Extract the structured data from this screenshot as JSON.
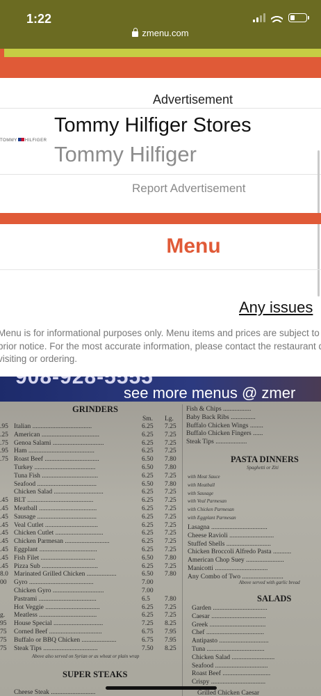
{
  "status_bar": {
    "time": "1:22",
    "battery_level": 0.3
  },
  "browser": {
    "url": "zmenu.com"
  },
  "ad": {
    "label": "Advertisement",
    "logo_text": "TOMMY HILFIGER",
    "title": "Tommy Hilfiger Stores",
    "subtitle": "Tommy Hilfiger",
    "report": "Report Advertisement"
  },
  "menu_heading": "Menu",
  "issues_link": "Any issues",
  "disclaimer": [
    "Menu is for informational purposes only. Menu items and prices are subject to",
    "prior notice. For the most accurate information, please contact the restaurant d",
    "visiting or ordering."
  ],
  "menu_image": {
    "banner_phone": "908-928-5555",
    "banner_text": "see more menus @ zmer",
    "grinders": {
      "title": "GRINDERS",
      "size_headers": [
        "Sm.",
        "Lg."
      ],
      "items": [
        {
          "name": "Italian",
          "sm": "6.25",
          "lg": "7.25"
        },
        {
          "name": "American",
          "sm": "6.25",
          "lg": "7.25"
        },
        {
          "name": "Genoa Salami",
          "sm": "6.25",
          "lg": "7.25"
        },
        {
          "name": "Ham",
          "sm": "6.25",
          "lg": "7.25"
        },
        {
          "name": "Roast Beef",
          "sm": "6.50",
          "lg": "7.80"
        },
        {
          "name": "Turkey",
          "sm": "6.50",
          "lg": "7.80"
        },
        {
          "name": "Tuna Fish",
          "sm": "6.25",
          "lg": "7.25"
        },
        {
          "name": "Seafood",
          "sm": "6.50",
          "lg": "7.80"
        },
        {
          "name": "Chicken Salad",
          "sm": "6.25",
          "lg": "7.25"
        },
        {
          "name": "BLT",
          "sm": "6.25",
          "lg": "7.25"
        },
        {
          "name": "Meatball",
          "sm": "6.25",
          "lg": "7.25"
        },
        {
          "name": "Sausage",
          "sm": "6.25",
          "lg": "7.25"
        },
        {
          "name": "Veal Cutlet",
          "sm": "6.25",
          "lg": "7.25"
        },
        {
          "name": "Chicken Cutlet",
          "sm": "6.25",
          "lg": "7.25"
        },
        {
          "name": "Chicken Parmesan",
          "sm": "6.25",
          "lg": "7.25"
        },
        {
          "name": "Eggplant",
          "sm": "6.25",
          "lg": "7.25"
        },
        {
          "name": "Fish Filet",
          "sm": "6.50",
          "lg": "7.80"
        },
        {
          "name": "Pizza Sub",
          "sm": "6.25",
          "lg": "7.25"
        },
        {
          "name": "Marinated Grilled Chicken",
          "sm": "6.50",
          "lg": "7.80"
        },
        {
          "name": "Gyro",
          "sm": "7.00",
          "lg": ""
        },
        {
          "name": "Chicken Gyro",
          "sm": "7.00",
          "lg": ""
        },
        {
          "name": "Pastrami",
          "sm": "6.5",
          "lg": "7.80"
        },
        {
          "name": "Hot Veggie",
          "sm": "6.25",
          "lg": "7.25"
        },
        {
          "name": "Meatless",
          "sm": "6.25",
          "lg": "7.25"
        },
        {
          "name": "House Special",
          "sm": "7.25",
          "lg": "8.25"
        },
        {
          "name": "Corned Beef",
          "sm": "6.75",
          "lg": "7.95"
        },
        {
          "name": "Buffalo or BBQ Chicken",
          "sm": "6.75",
          "lg": "7.95"
        },
        {
          "name": "Steak Tips",
          "sm": "7.50",
          "lg": "8.25"
        }
      ],
      "note": "Above also served on Syrian or as wheat or plain wrap"
    },
    "left_edge_prices": [
      ".95",
      ".25",
      ".75",
      ".95",
      ".75",
      "",
      "",
      "",
      "",
      ".45",
      ".45",
      ".45",
      ".45",
      ".45",
      ".45",
      ".45",
      ".45",
      ".45",
      "8.0",
      "00",
      "",
      "",
      "",
      "g.",
      "95",
      "75",
      "75",
      "75"
    ],
    "super_steaks": {
      "title": "SUPER STEAKS",
      "first_item": "Cheese Steak"
    },
    "right_top": [
      "Fish & Chips",
      "Baby Back Ribs",
      "Buffalo Chicken Wings",
      "Buffalo Chicken Fingers",
      "Steak Tips"
    ],
    "pasta": {
      "title": "PASTA DINNERS",
      "subtitle": "Spaghetti or Ziti",
      "options": [
        "with Meat Sauce",
        "with Meatball",
        "with Sausage",
        "with Veal Parmesan",
        "with Chicken Parmesan",
        "with Eggplant Parmesan"
      ],
      "items": [
        "Lasagna",
        "Cheese Ravioli",
        "Stuffed Shells",
        "Chicken Broccoli Alfredo Pasta",
        "American Chop Suey",
        "Manicotti",
        "Any Combo of Two"
      ],
      "note": "Above served with garlic bread"
    },
    "salads": {
      "title": "SALADS",
      "items": [
        "Garden",
        "Caesar",
        "Greek",
        "Chef",
        "Antipasto",
        "Tuna",
        "Chicken Salad",
        "Seafood",
        "Roast Beef",
        "Crispy"
      ],
      "extra": "Grilled Chicken Caesar"
    }
  },
  "colors": {
    "orange": "#e05a37",
    "green_accent": "#c6cc44",
    "status_bg": "#6b6b22"
  }
}
